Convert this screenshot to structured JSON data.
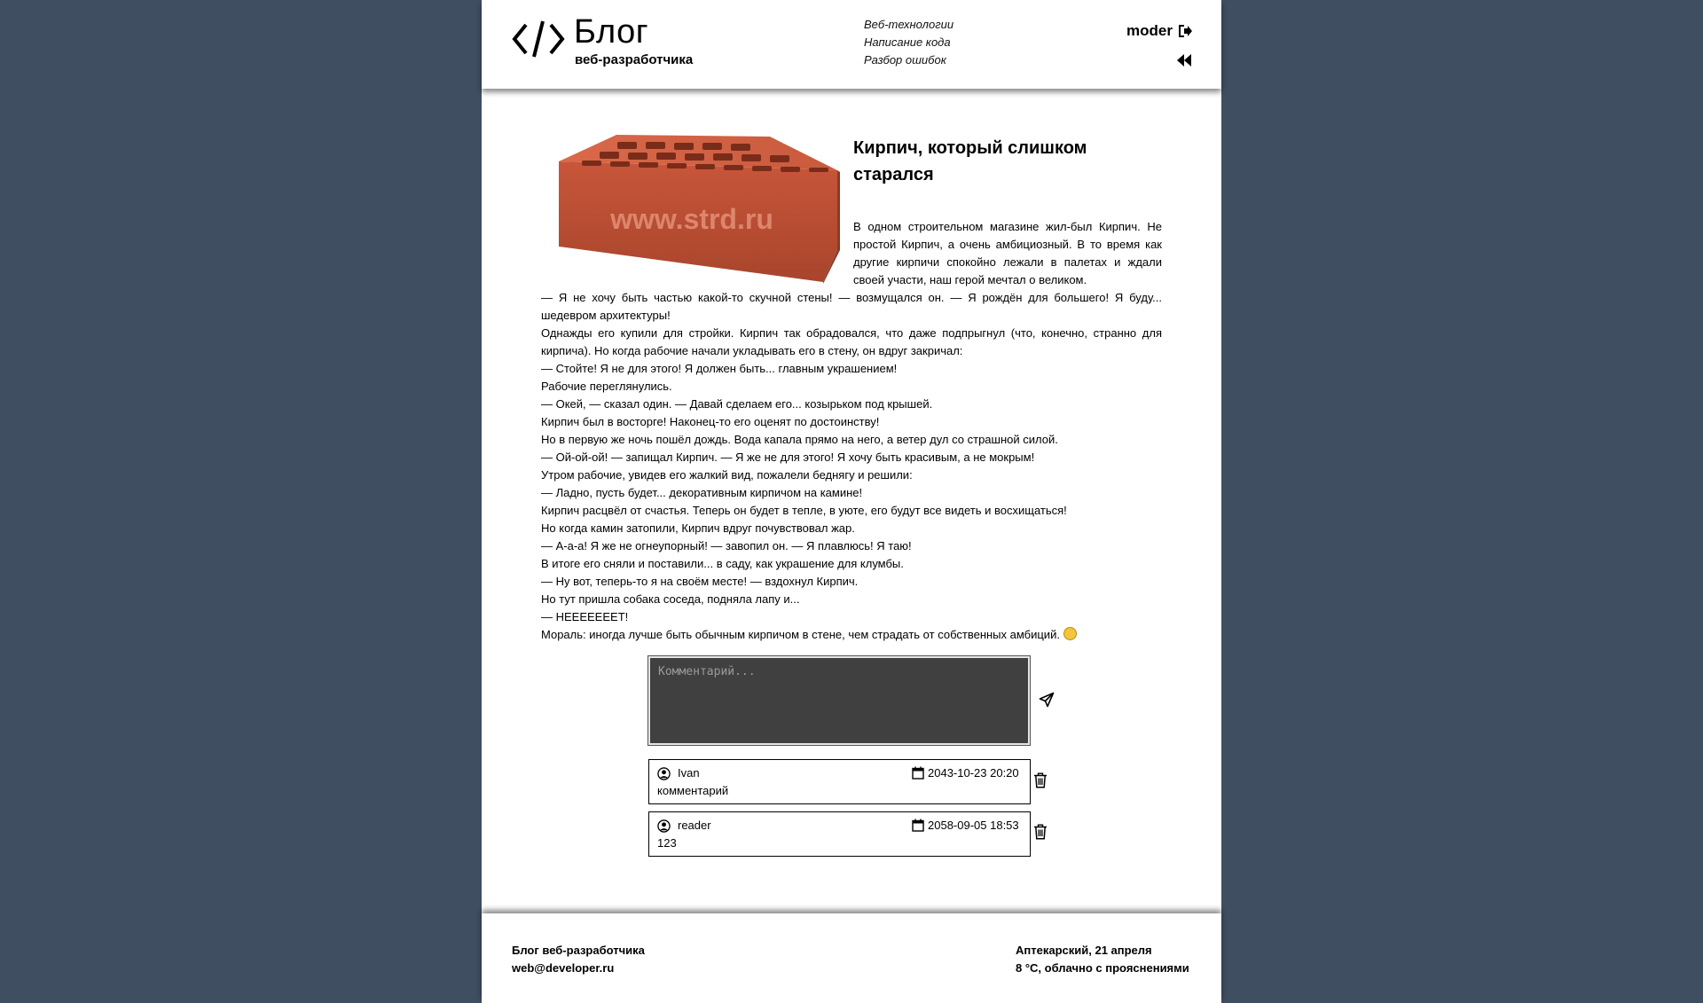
{
  "header": {
    "logo_title": "Блог",
    "logo_subtitle": "веб-разработчика",
    "nav": [
      {
        "label": "Веб-технологии"
      },
      {
        "label": "Написание кода"
      },
      {
        "label": "Разбор ошибок"
      }
    ],
    "username": "moder",
    "icons": {
      "logo": "code-brackets-icon",
      "logout": "logout-icon",
      "collapse": "double-chevron-left-icon"
    }
  },
  "article": {
    "title": "Кирпич, который слишком старался",
    "image_watermark": "www.strd.ru",
    "paragraphs": [
      "В одном строительном магазине жил-был Кирпич. Не простой Кирпич, а очень амбициозный. В то время как другие кирпичи спокойно лежали в палетах и ждали своей участи, наш герой мечтал о великом.",
      "— Я не хочу быть частью какой-то скучной стены! — возмущался он. — Я рождён для большего! Я буду... шедевром архитектуры!",
      "Однажды его купили для стройки. Кирпич так обрадовался, что даже подпрыгнул (что, конечно, странно для кирпича). Но когда рабочие начали укладывать его в стену, он вдруг закричал:",
      "— Стойте! Я не для этого! Я должен быть... главным украшением!",
      "Рабочие переглянулись.",
      "— Окей, — сказал один. — Давай сделаем его... козырьком под крышей.",
      "Кирпич был в восторге! Наконец-то его оценят по достоинству!",
      "Но в первую же ночь пошёл дождь. Вода капала прямо на него, а ветер дул со страшной силой.",
      "— Ой-ой-ой! — запищал Кирпич. — Я же не для этого! Я хочу быть красивым, а не мокрым!",
      "Утром рабочие, увидев его жалкий вид, пожалели беднягу и решили:",
      "— Ладно, пусть будет... декоративным кирпичом на камине!",
      "Кирпич расцвёл от счастья. Теперь он будет в тепле, в уюте, его будут все видеть и восхищаться!",
      "Но когда камин затопили, Кирпич вдруг почувствовал жар.",
      "— А-а-а! Я же не огнеупорный! — завопил он. — Я плавлюсь! Я таю!",
      "В итоге его сняли и поставили... в саду, как украшение для клумбы.",
      "— Ну вот, теперь-то я на своём месте! — вздохнул Кирпич.",
      "Но тут пришла собака соседа, подняла лапу и...",
      "— НЕЕЕЕЕЕЕТ!",
      "Мораль: иногда лучше быть обычным кирпичом в стене, чем страдать от собственных амбиций."
    ]
  },
  "comment_form": {
    "placeholder": "Комментарий...",
    "value": ""
  },
  "comments": [
    {
      "author": "Ivan",
      "date": "2043-10-23 20:20",
      "text": "комментарий"
    },
    {
      "author": "reader",
      "date": "2058-09-05 18:53",
      "text": "123"
    }
  ],
  "footer": {
    "left_line1": "Блог веб-разработчика",
    "left_line2": "web@developer.ru",
    "right_line1": "Аптекарский, 21 апреля",
    "right_line2": "8 °C, облачно с прояснениями"
  }
}
